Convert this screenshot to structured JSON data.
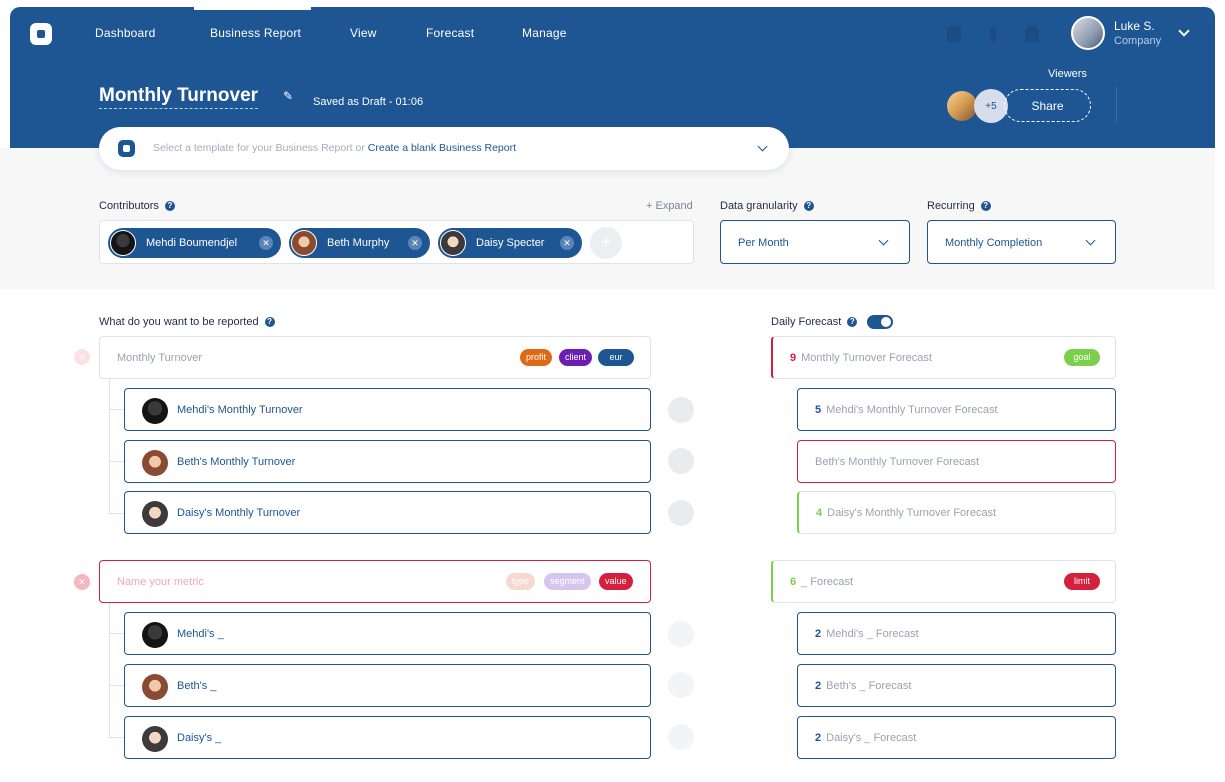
{
  "nav": {
    "items": [
      "Dashboard",
      "Business Report",
      "View",
      "Forecast",
      "Manage"
    ],
    "active": "Business Report"
  },
  "user": {
    "name": "Luke S.",
    "company": "Company"
  },
  "report": {
    "title": "Monthly Turnover",
    "saved_status": "Saved as Draft - 01:06",
    "viewers_label": "Viewers",
    "viewers_more": "+5",
    "share_label": "Share"
  },
  "template": {
    "prompt": "Select a template for your Business Report or",
    "link": "Create a blank Business Report"
  },
  "contributors": {
    "label": "Contributors",
    "expand": "+ Expand",
    "chips": [
      {
        "name": "Mehdi Boumendjel"
      },
      {
        "name": "Beth Murphy"
      },
      {
        "name": "Daisy Specter"
      }
    ]
  },
  "granularity": {
    "label": "Data granularity",
    "value": "Per Month"
  },
  "recurring": {
    "label": "Recurring",
    "value": "Monthly Completion"
  },
  "reported": {
    "label": "What do you want to be reported",
    "metric1": {
      "title": "Monthly Turnover",
      "tags": [
        "profit",
        "client",
        "eur"
      ],
      "subs": [
        "Mehdi's Monthly Turnover",
        "Beth's Monthly Turnover",
        "Daisy's Monthly Turnover"
      ]
    },
    "metric2": {
      "placeholder": "Name your metric",
      "tags": [
        "type",
        "segment",
        "value"
      ],
      "subs": [
        "Mehdi's _",
        "Beth's _",
        "Daisy's _"
      ]
    }
  },
  "forecast": {
    "label": "Daily Forecast",
    "f1": {
      "num": "9",
      "title": "Monthly Turnover Forecast",
      "tag": "goal"
    },
    "f1_subs": [
      {
        "num": "5",
        "title": "Mehdi's Monthly Turnover Forecast"
      },
      {
        "num": "",
        "title": "Beth's Monthly Turnover Forecast"
      },
      {
        "num": "4",
        "title": "Daisy's Monthly Turnover Forecast"
      }
    ],
    "f2": {
      "num": "6",
      "title": "_ Forecast",
      "tag": "limit"
    },
    "f2_subs": [
      {
        "num": "2",
        "title": "Mehdi's _ Forecast"
      },
      {
        "num": "2",
        "title": "Beth's _ Forecast"
      },
      {
        "num": "2",
        "title": "Daisy's _ Forecast"
      }
    ]
  },
  "colors": {
    "brand": "#1e5593",
    "danger": "#d41f3d",
    "success": "#7ccf4a",
    "tag_profit": "#e06a14",
    "tag_client": "#6a1fb0",
    "tag_eur": "#1e5593"
  }
}
